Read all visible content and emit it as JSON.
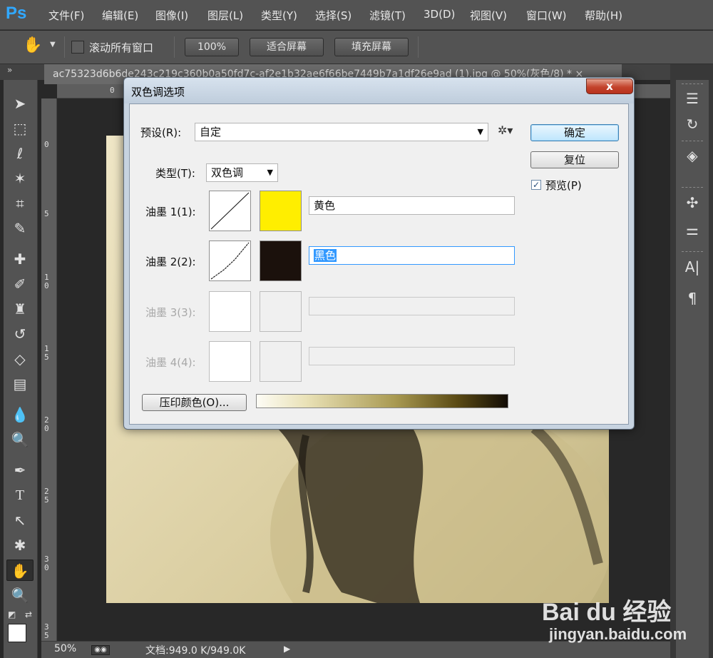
{
  "app": {
    "logo": "Ps",
    "menu": [
      "文件(F)",
      "编辑(E)",
      "图像(I)",
      "图层(L)",
      "类型(Y)",
      "选择(S)",
      "滤镜(T)",
      "3D(D)",
      "视图(V)",
      "窗口(W)",
      "帮助(H)"
    ]
  },
  "options_bar": {
    "scroll_all_label": "滚动所有窗口",
    "zoom_100": "100%",
    "fit_screen": "适合屏幕",
    "fill_screen": "填充屏幕"
  },
  "document": {
    "tab_title": "ac75323d6b6de243c219c360b0a50fd7c-af2e1b32ae6f66be7449b7a1df26e9ad (1).jpg @ 50%(灰色/8) * ×",
    "ruler_top_label": "0",
    "ruler_left_labels": [
      "0",
      "5",
      "1 0",
      "1 5",
      "2 0",
      "2 5",
      "3 0",
      "3 5"
    ]
  },
  "status": {
    "zoom": "50%",
    "doc_info": "文档:949.0 K/949.0K"
  },
  "dialog": {
    "title": "双色调选项",
    "close_glyph": "x",
    "preset_label": "预设(R):",
    "preset_value": "自定",
    "type_label": "类型(T):",
    "type_value": "双色调",
    "inks": [
      {
        "label": "油墨 1(1):",
        "color_name": "黄色",
        "swatch": "#ffee00",
        "enabled": true
      },
      {
        "label": "油墨 2(2):",
        "color_name": "黑色",
        "swatch": "#1b110c",
        "enabled": true
      },
      {
        "label": "油墨 3(3):",
        "color_name": "",
        "swatch": "",
        "enabled": false
      },
      {
        "label": "油墨 4(4):",
        "color_name": "",
        "swatch": "",
        "enabled": false
      }
    ],
    "ok_label": "确定",
    "reset_label": "复位",
    "preview_label": "预览(P)",
    "preview_checked": true,
    "overprint_label": "压印颜色(O)..."
  },
  "watermark": {
    "brand": "Bai du 经验",
    "url": "jingyan.baidu.com"
  }
}
